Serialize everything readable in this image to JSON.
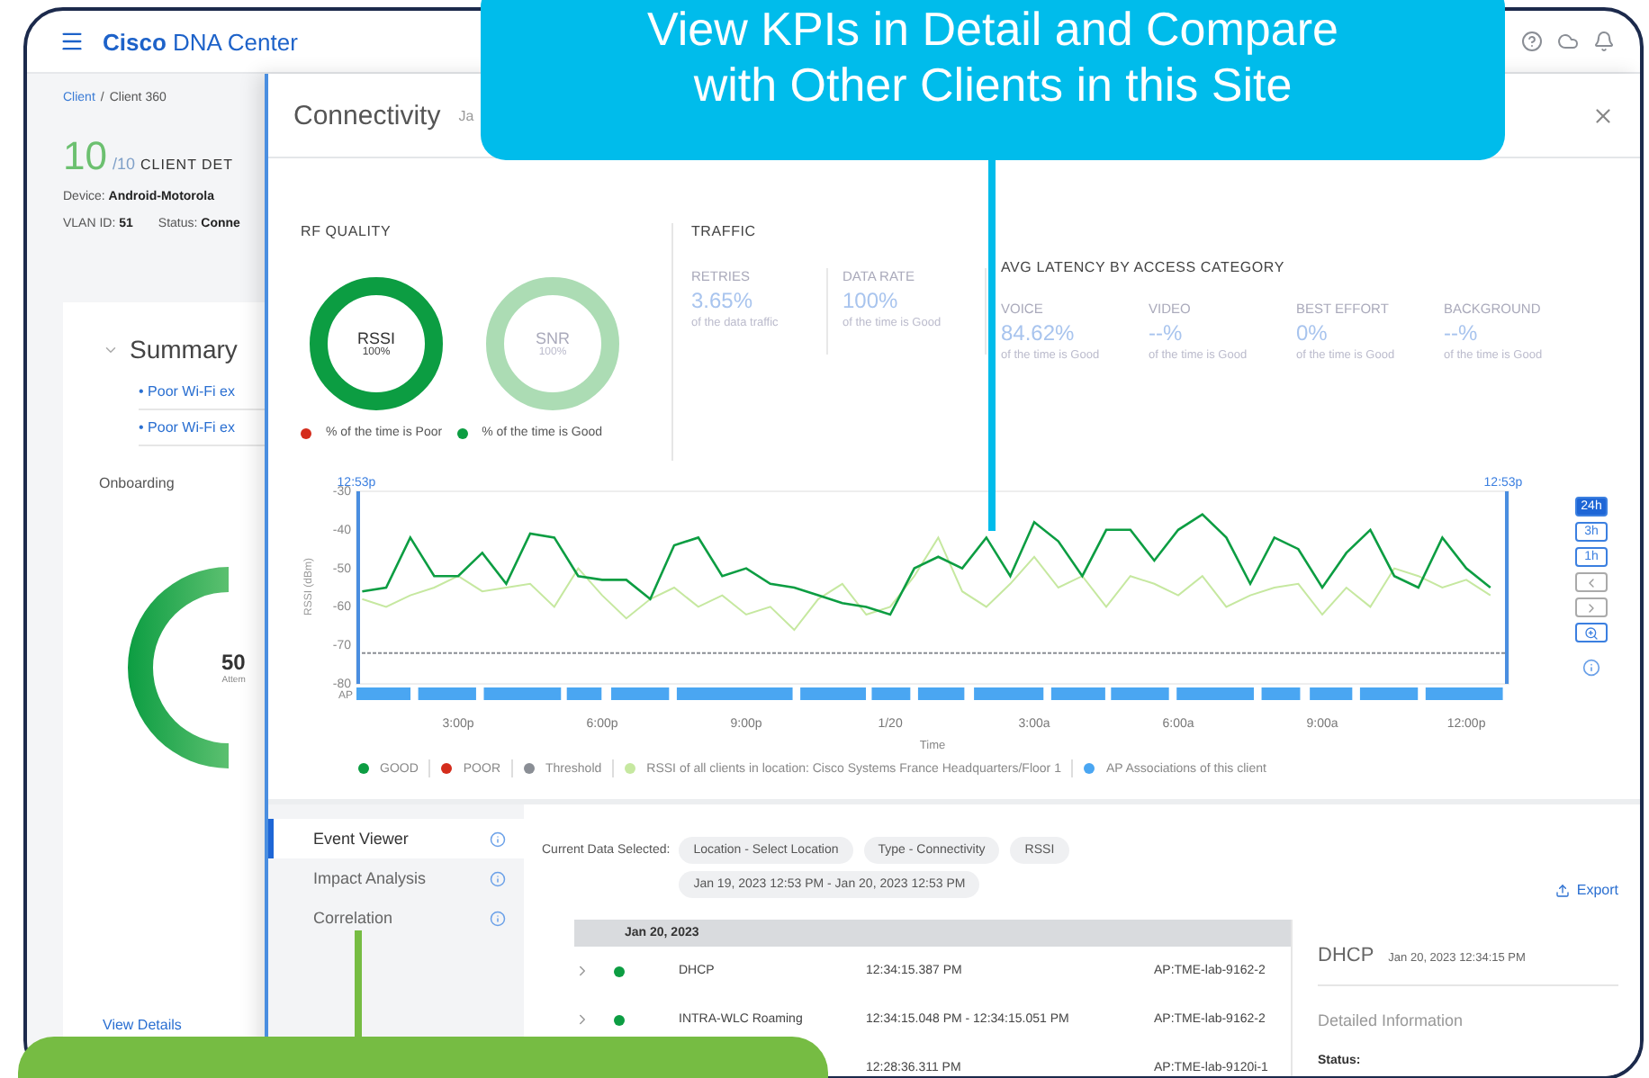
{
  "callout": {
    "text": "View KPIs in Detail and Compare with Other Clients in this Site"
  },
  "header": {
    "brand_bold": "Cisco",
    "brand": "DNA Center"
  },
  "background_page": {
    "breadcrumb": [
      "Client",
      "Client 360"
    ],
    "separator": "/",
    "score": "10",
    "score_max": "/10",
    "title": "CLIENT DET",
    "device": "Device: **Android-Motorola**",
    "vlan": "VLAN ID: **51**",
    "status": "Status: **Conne**",
    "summary_title": "Summary",
    "bullet": "•",
    "issues": [
      "Poor Wi-Fi ex",
      "Poor Wi-Fi ex"
    ],
    "onboarding": "Onboarding",
    "donut_value": "50",
    "donut_label": "Attem",
    "view_details": "View Details"
  },
  "panel": {
    "title": "Connectivity",
    "subtitle": "Ja",
    "rf_quality": {
      "title": "RF QUALITY",
      "donuts": [
        {
          "label": "RSSI",
          "value": "100%",
          "color": "#0c9d42",
          "dimmed": false
        },
        {
          "label": "SNR",
          "value": "100%",
          "color": "#acdcb4",
          "dimmed": true
        }
      ],
      "legend": [
        {
          "label": "% of the time is Poor",
          "color": "#d42c1c"
        },
        {
          "label": "% of the time is Good",
          "color": "#0c9d42"
        }
      ]
    },
    "traffic": {
      "title": "TRAFFIC",
      "metrics": [
        {
          "label": "RETRIES",
          "value": "3.65%",
          "note": "of the data traffic"
        },
        {
          "label": "DATA RATE",
          "value": "100%",
          "note": "of the time is Good"
        }
      ]
    },
    "latency": {
      "title": "AVG LATENCY BY ACCESS CATEGORY",
      "metrics": [
        {
          "label": "VOICE",
          "value": "84.62%",
          "note": "of the time is Good"
        },
        {
          "label": "VIDEO",
          "value": "--%",
          "note": "of the time is Good"
        },
        {
          "label": "BEST EFFORT",
          "value": "0%",
          "note": "of the time is Good"
        },
        {
          "label": "BACKGROUND",
          "value": "--%",
          "note": "of the time is Good"
        }
      ]
    },
    "chart": {
      "start_label": "12:53p",
      "end_label": "12:53p",
      "ap_label": "AP",
      "chart_data": {
        "type": "line",
        "xlabel": "Time",
        "ylabel": "RSSI (dBm)",
        "ylim": [
          -80,
          -30
        ],
        "categories": [
          null,
          null,
          null,
          null,
          "3:00p",
          null,
          null,
          null,
          null,
          null,
          "6:00p",
          null,
          null,
          null,
          null,
          null,
          "9:00p",
          null,
          null,
          null,
          null,
          null,
          "1/20",
          null,
          null,
          null,
          null,
          null,
          "3:00a",
          null,
          null,
          null,
          null,
          null,
          "6:00a",
          null,
          null,
          null,
          null,
          null,
          "9:00a",
          null,
          null,
          null,
          null,
          null,
          "12:00p",
          null
        ],
        "series": [
          {
            "name": "GOOD",
            "color": "#0c9d42",
            "values": [
              -56,
              -55,
              -42,
              -52,
              -52,
              -46,
              -54,
              -41,
              -42,
              -52,
              -53,
              -53,
              -58,
              -44,
              -42,
              -52,
              -50,
              -54,
              -55,
              -57,
              -59,
              -60,
              -62,
              -50,
              -47,
              -50,
              -42,
              -52,
              -38,
              -43,
              -52,
              -40,
              -40,
              -48,
              -40,
              -36,
              -42,
              -54,
              -42,
              -45,
              -55,
              -46,
              -40,
              -52,
              -55,
              -42,
              -50,
              -55
            ]
          },
          {
            "name": "RSSI of all clients in location: Cisco Systems France Headquarters/Floor 1",
            "color": "#c6e8a0",
            "values": [
              -58,
              -60,
              -57,
              -55,
              -52,
              -56,
              -55,
              -54,
              -60,
              -50,
              -57,
              -63,
              -58,
              -55,
              -60,
              -57,
              -62,
              -60,
              -66,
              -58,
              -54,
              -62,
              -60,
              -52,
              -42,
              -56,
              -60,
              -54,
              -47,
              -55,
              -52,
              -60,
              -52,
              -54,
              -57,
              -52,
              -60,
              -57,
              -55,
              -54,
              -62,
              -55,
              -60,
              -50,
              -52,
              -55,
              -53,
              -57
            ]
          }
        ],
        "yticks": [
          -30,
          -40,
          -50,
          -60,
          -70,
          -80
        ],
        "ref_lines": [
          {
            "axis": "y",
            "value": -72
          }
        ]
      },
      "ranges": [
        {
          "label": "24h",
          "selected": true
        },
        {
          "label": "3h",
          "selected": false
        },
        {
          "label": "1h",
          "selected": false
        }
      ],
      "legend": [
        {
          "kind": "series"
        },
        {
          "kind": "item",
          "label": "POOR",
          "color": "#d42c1c"
        },
        {
          "kind": "item",
          "label": "Threshold",
          "color": "#8a8e95"
        },
        {
          "kind": "series"
        },
        {
          "kind": "item",
          "label": "AP Associations of this client",
          "color": "#4aa6f2"
        }
      ]
    },
    "nav": [
      {
        "label": "Event Viewer",
        "selected": true
      },
      {
        "label": "Impact Analysis",
        "selected": false
      },
      {
        "label": "Correlation",
        "selected": false
      }
    ],
    "filters": {
      "label": "Current Data Selected:",
      "chips": [
        "Location - Select Location",
        "Type - Connectivity",
        "RSSI",
        "Jan 19, 2023 12:53 PM - Jan 20, 2023 12:53 PM"
      ]
    },
    "export": "Export",
    "events": {
      "group": "Jan 20, 2023",
      "rows": [
        {
          "event": "DHCP",
          "time": "12:34:15.387 PM",
          "device": "AP:TME-lab-9162-2"
        },
        {
          "event": "INTRA-WLC Roaming",
          "time": "12:34:15.048 PM - 12:34:15.051 PM",
          "device": "AP:TME-lab-9162-2"
        },
        {
          "time": "12:28:36.311 PM",
          "device": "AP:TME-lab-9120i-1"
        }
      ]
    },
    "detail": {
      "title": "DHCP",
      "time": "Jan 20, 2023 12:34:15 PM",
      "section": "Detailed Information",
      "status_label": "Status:"
    }
  }
}
